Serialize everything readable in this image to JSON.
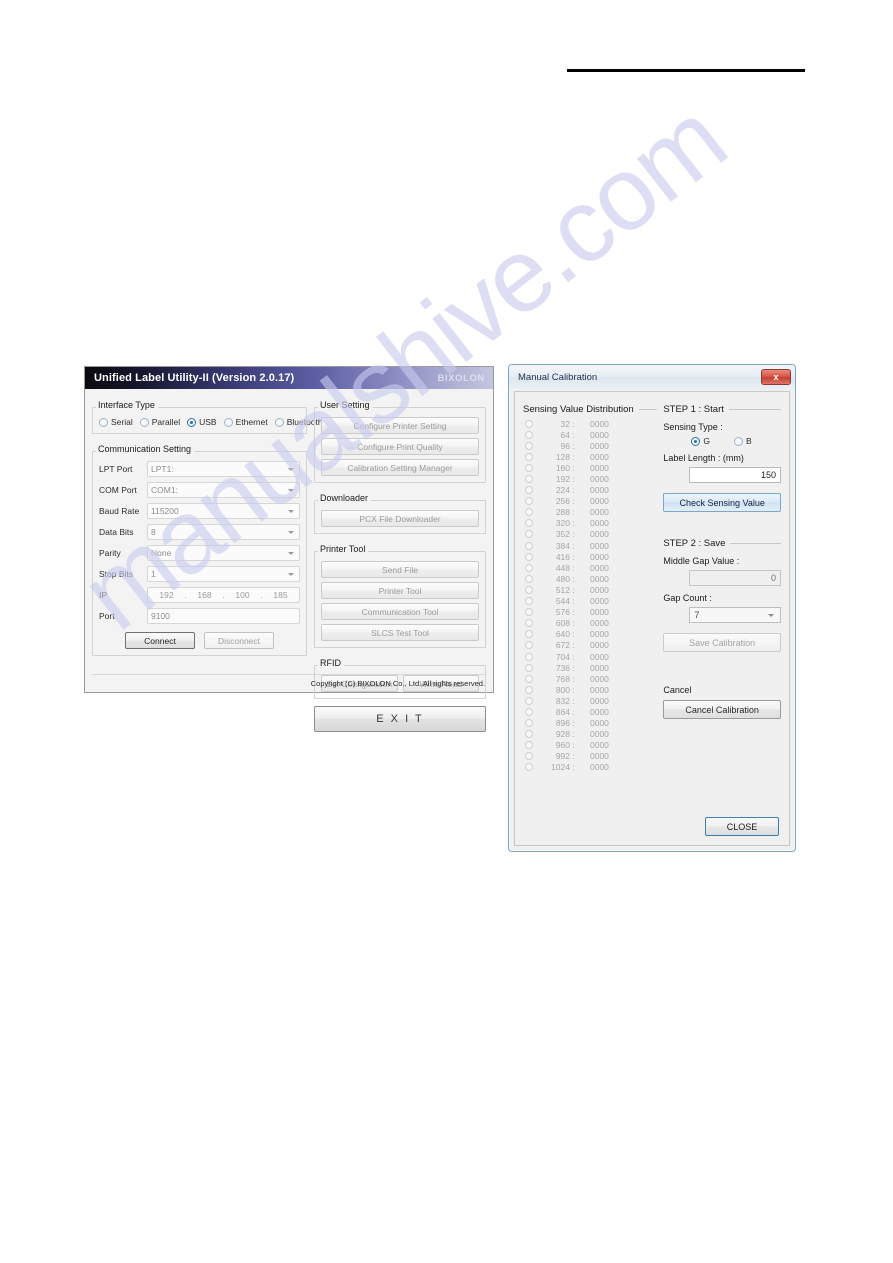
{
  "page": {
    "watermark": "manualshive.com"
  },
  "ulu": {
    "title": "Unified Label Utility-II (Version 2.0.17)",
    "brand": "BIXOLON",
    "interface_group": "Interface Type",
    "interface_options": [
      {
        "label": "Serial",
        "selected": false
      },
      {
        "label": "Parallel",
        "selected": false
      },
      {
        "label": "USB",
        "selected": true
      },
      {
        "label": "Ethernet",
        "selected": false
      },
      {
        "label": "Bluetooth",
        "selected": false
      }
    ],
    "comm_group": "Communication Setting",
    "fields": [
      {
        "label": "LPT Port",
        "value": "LPT1:",
        "type": "combo"
      },
      {
        "label": "COM Port",
        "value": "COM1:",
        "type": "combo"
      },
      {
        "label": "Baud Rate",
        "value": "115200",
        "type": "combo"
      },
      {
        "label": "Data Bits",
        "value": "8",
        "type": "combo"
      },
      {
        "label": "Parity",
        "value": "None",
        "type": "combo"
      },
      {
        "label": "Stop Bits",
        "value": "1",
        "type": "combo"
      }
    ],
    "ip_label": "IP",
    "ip_octets": [
      "192",
      "168",
      "100",
      "185"
    ],
    "port_label": "Port",
    "port_value": "9100",
    "connect_label": "Connect",
    "disconnect_label": "Disconnect",
    "user_setting_group": "User Setting",
    "user_setting_buttons": [
      "Configure Printer Setting",
      "Configure Print Quality",
      "Calibration Setting Manager"
    ],
    "downloader_group": "Downloader",
    "downloader_buttons": [
      "PCX File Downloader"
    ],
    "printer_tool_group": "Printer Tool",
    "printer_tool_buttons": [
      "Send File",
      "Printer Tool",
      "Communication Tool",
      "SLCS Test Tool"
    ],
    "rfid_group": "RFID",
    "rfid_buttons": [
      "Set Configuration",
      "Write/Read"
    ],
    "exit_label": "E X I T",
    "copyright": "Copyright (C) BIXOLON Co., Ltd. All rights reserved."
  },
  "calibration": {
    "title": "Manual Calibration",
    "close_glyph": "x",
    "distribution_header": "Sensing Value Distribution",
    "distribution_rows": [
      {
        "key": "32",
        "value": "0000"
      },
      {
        "key": "64",
        "value": "0000"
      },
      {
        "key": "96",
        "value": "0000"
      },
      {
        "key": "128",
        "value": "0000"
      },
      {
        "key": "160",
        "value": "0000"
      },
      {
        "key": "192",
        "value": "0000"
      },
      {
        "key": "224",
        "value": "0000"
      },
      {
        "key": "256",
        "value": "0000"
      },
      {
        "key": "288",
        "value": "0000"
      },
      {
        "key": "320",
        "value": "0000"
      },
      {
        "key": "352",
        "value": "0000"
      },
      {
        "key": "384",
        "value": "0000"
      },
      {
        "key": "416",
        "value": "0000"
      },
      {
        "key": "448",
        "value": "0000"
      },
      {
        "key": "480",
        "value": "0000"
      },
      {
        "key": "512",
        "value": "0000"
      },
      {
        "key": "544",
        "value": "0000"
      },
      {
        "key": "576",
        "value": "0000"
      },
      {
        "key": "608",
        "value": "0000"
      },
      {
        "key": "640",
        "value": "0000"
      },
      {
        "key": "672",
        "value": "0000"
      },
      {
        "key": "704",
        "value": "0000"
      },
      {
        "key": "736",
        "value": "0000"
      },
      {
        "key": "768",
        "value": "0000"
      },
      {
        "key": "800",
        "value": "0000"
      },
      {
        "key": "832",
        "value": "0000"
      },
      {
        "key": "864",
        "value": "0000"
      },
      {
        "key": "896",
        "value": "0000"
      },
      {
        "key": "928",
        "value": "0000"
      },
      {
        "key": "960",
        "value": "0000"
      },
      {
        "key": "992",
        "value": "0000"
      },
      {
        "key": "1024",
        "value": "0000"
      }
    ],
    "step1_header": "STEP 1 : Start",
    "sensing_type_label": "Sensing Type :",
    "sensing_type_options": [
      {
        "label": "G",
        "selected": true
      },
      {
        "label": "B",
        "selected": false
      }
    ],
    "label_length_label": "Label Length : (mm)",
    "label_length_value": "150",
    "check_sensing_label": "Check Sensing Value",
    "step2_header": "STEP 2 : Save",
    "middle_gap_label": "Middle Gap Value :",
    "middle_gap_value": "0",
    "gap_count_label": "Gap Count :",
    "gap_count_value": "7",
    "save_calibration_label": "Save Calibration",
    "cancel_label": "Cancel",
    "cancel_calibration_label": "Cancel Calibration",
    "close_label": "CLOSE"
  }
}
